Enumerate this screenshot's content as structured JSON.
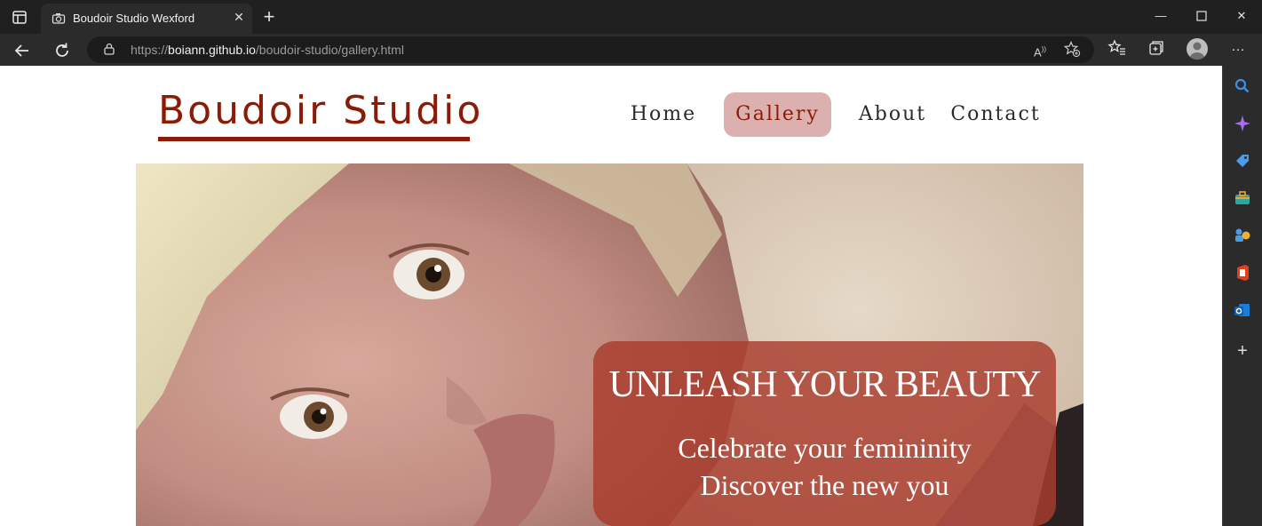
{
  "browser": {
    "tab_title": "Boudoir Studio Wexford",
    "url_prefix": "https://",
    "url_host": "boiann.github.io",
    "url_path": "/boudoir-studio/gallery.html"
  },
  "site": {
    "brand": "Boudoir Studio",
    "brand_color": "#8b1a06",
    "nav": [
      {
        "label": "Home",
        "active": false
      },
      {
        "label": "Gallery",
        "active": true
      },
      {
        "label": "About",
        "active": false
      },
      {
        "label": "Contact",
        "active": false
      }
    ]
  },
  "hero": {
    "headline": "UNLEASH YOUR BEAUTY",
    "line1": "Celebrate your femininity",
    "line2": "Discover the new you"
  }
}
